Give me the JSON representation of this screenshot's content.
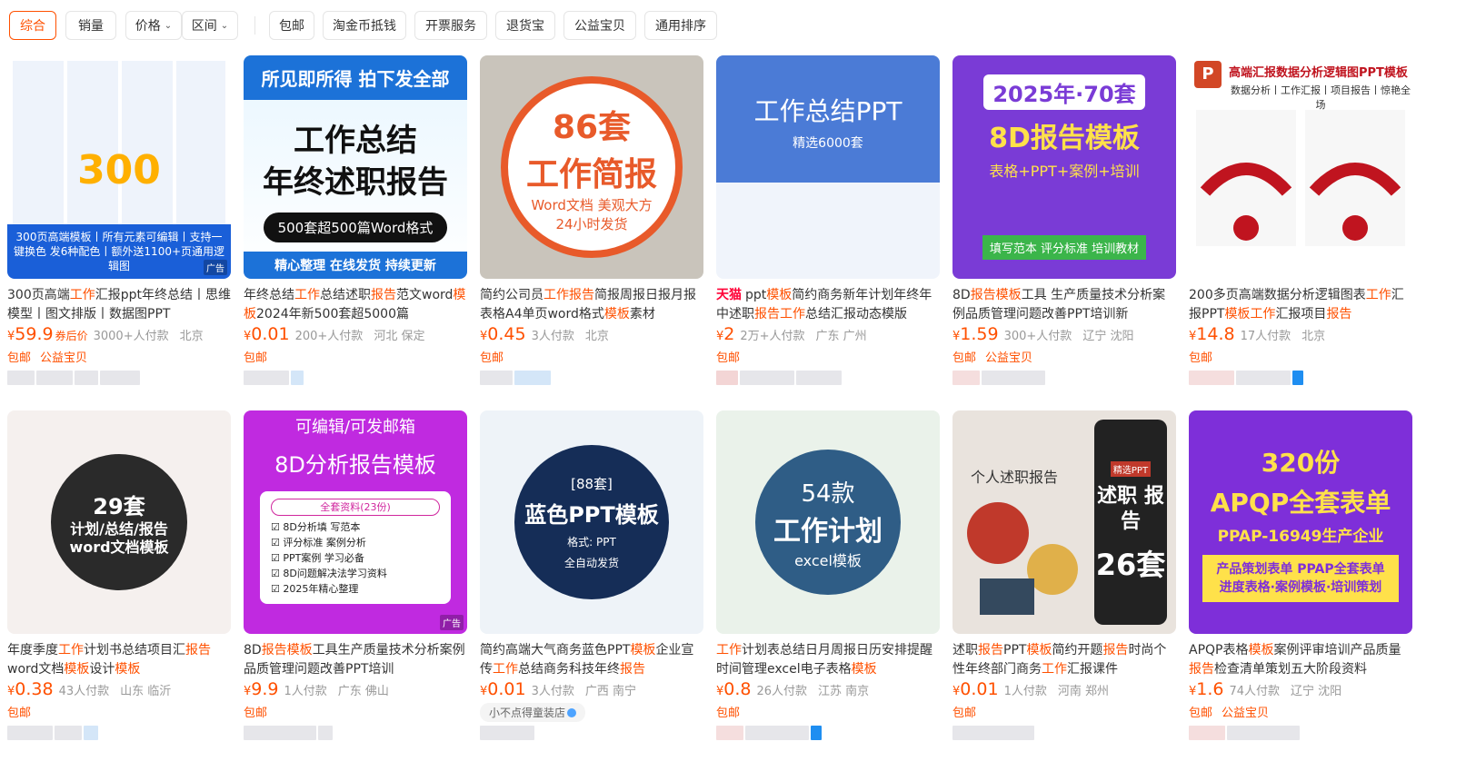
{
  "filters": [
    {
      "label": "综合",
      "active": true
    },
    {
      "label": "销量"
    },
    {
      "label": "价格",
      "dropdown": true
    },
    {
      "label": "区间",
      "dropdown": true
    },
    {
      "label": "包邮"
    },
    {
      "label": "淘金币抵钱"
    },
    {
      "label": "开票服务"
    },
    {
      "label": "退货宝"
    },
    {
      "label": "公益宝贝"
    },
    {
      "label": "通用排序"
    }
  ],
  "thumbs": {
    "p1": {
      "big": "300",
      "band": "300页高端模板丨所有元素可编辑丨支持一键换色 发6种配色丨额外送1100+页通用逻辑图",
      "ad": "广告"
    },
    "p2": {
      "top": "所见即所得 拍下发全部",
      "h1": "工作总结",
      "h2": "年终述职报告",
      "pill": "500套超500篇Word格式",
      "bottom": "精心整理  在线发货  持续更新"
    },
    "p3": {
      "n": "86套",
      "m": "工作简报",
      "s1": "Word文档 美观大方",
      "s2": "24小时发货"
    },
    "p4": {
      "a": "工作总结PPT",
      "b": "精选6000套"
    },
    "p5": {
      "yr": "2025年·70套",
      "h": "8D报告模板",
      "sub": "表格+PPT+案例+培训",
      "green": "填写范本 评分标准 培训教材"
    },
    "p6": {
      "h": "高端汇报数据分析逻辑图PPT模板",
      "sub": "数据分析丨工作汇报丨项目报告丨惊艳全场",
      "logo": "P"
    },
    "p7": {
      "n": "29套",
      "m": "计划/总结/报告 word文档模板"
    },
    "p8": {
      "top": "可编辑/可发邮箱",
      "h": "8D分析报告模板",
      "pill": "全套资料(23份)",
      "l1": "8D分析填  写范本",
      "l2": "评分标准  案例分析",
      "l3": "PPT案例  学习必备",
      "l4": "8D问题解决法学习资料",
      "l5": "2025年精心整理",
      "ad": "广告"
    },
    "p9": {
      "n": "[88套]",
      "m": "蓝色PPT模板",
      "s1": "格式: PPT",
      "s2": "全自动发货"
    },
    "p10": {
      "n": "54款",
      "m": "工作计划",
      "s": "excel模板"
    },
    "p11": {
      "left": "个人述职报告",
      "a": "精选PPT",
      "b": "述职 报告",
      "c": "26套"
    },
    "p12": {
      "n": "320份",
      "h": "APQP全套表单",
      "s": "PPAP-16949生产企业",
      "y": "产品策划表单 PPAP全套表单 进度表格·案例模板·培训策划"
    }
  },
  "products": [
    {
      "title_parts": [
        "300页高端",
        "工作",
        "汇报ppt年终总结丨思维模型丨图文排版丨数据图PPT"
      ],
      "price": "59.9",
      "coupon": "券后价",
      "sold": "3000+人付款",
      "loc": "北京",
      "tags": [
        "包邮",
        "公益宝贝"
      ]
    },
    {
      "title_parts": [
        "年终总结",
        "工作",
        "总结述职",
        "报告",
        "范文word",
        "模板",
        "2024年新500套超5000篇"
      ],
      "price": "0.01",
      "sold": "200+人付款",
      "loc": "河北 保定",
      "tags": [
        "包邮"
      ]
    },
    {
      "title_parts": [
        "简约公司员",
        "工作报告",
        "简报周报日报月报表格A4单页word格式",
        "模板",
        "素材"
      ],
      "price": "0.45",
      "sold": "3人付款",
      "loc": "北京",
      "tags": [
        "包邮"
      ]
    },
    {
      "tmall": "天猫",
      "title_parts": [
        "ppt",
        "模板",
        "简约商务新年计划年终年中述职",
        "报告",
        "",
        "工作",
        "总结汇报动态模版"
      ],
      "price": "2",
      "sold": "2万+人付款",
      "loc": "广东 广州",
      "tags": [
        "包邮"
      ]
    },
    {
      "title_parts": [
        "8D",
        "报告模板",
        "工具 生产质量技术分析案例品质管理问题改善PPT培训新"
      ],
      "price": "1.59",
      "sold": "300+人付款",
      "loc": "辽宁 沈阳",
      "tags": [
        "包邮",
        "公益宝贝"
      ]
    },
    {
      "title_parts": [
        "200多页高端数据分析逻辑图表",
        "工作",
        "汇报PPT",
        "模板",
        "",
        "工作",
        "汇报项目",
        "报告",
        ""
      ],
      "price": "14.8",
      "sold": "17人付款",
      "loc": "北京",
      "tags": [
        "包邮"
      ]
    },
    {
      "title_parts": [
        "年度季度",
        "工作",
        "计划书总结项目汇",
        "报告",
        "word文档",
        "模板",
        "设计",
        "模板",
        ""
      ],
      "price": "0.38",
      "sold": "43人付款",
      "loc": "山东 临沂",
      "tags": [
        "包邮"
      ]
    },
    {
      "title_parts": [
        "8D",
        "报告模板",
        "工具生产质量技术分析案例品质管理问题改善PPT培训"
      ],
      "price": "9.9",
      "sold": "1人付款",
      "loc": "广东 佛山",
      "tags": [
        "包邮"
      ]
    },
    {
      "title_parts": [
        "简约高端大气商务蓝色PPT",
        "模板",
        "企业宣传",
        "工作",
        "总结商务科技年终",
        "报告",
        ""
      ],
      "price": "0.01",
      "sold": "3人付款",
      "loc": "广西 南宁",
      "tags": [],
      "shoptag": "小不点得童装店"
    },
    {
      "title_parts": [
        "",
        "工作",
        "计划表总结日月周报日历安排提醒时间管理excel电子表格",
        "模板",
        ""
      ],
      "price": "0.8",
      "sold": "26人付款",
      "loc": "江苏 南京",
      "tags": [
        "包邮"
      ]
    },
    {
      "title_parts": [
        "述职",
        "报告",
        "PPT",
        "模板",
        "简约开题",
        "报告",
        "时尚个性年终部门商务",
        "工作",
        "汇报课件"
      ],
      "price": "0.01",
      "sold": "1人付款",
      "loc": "河南 郑州",
      "tags": [
        "包邮"
      ]
    },
    {
      "title_parts": [
        "APQP表格",
        "模板",
        "案例评审培训产品质量",
        "报告",
        "检查清单策划五大阶段资料"
      ],
      "price": "1.6",
      "sold": "74人付款",
      "loc": "辽宁 沈阳",
      "tags": [
        "包邮",
        "公益宝贝"
      ]
    }
  ]
}
